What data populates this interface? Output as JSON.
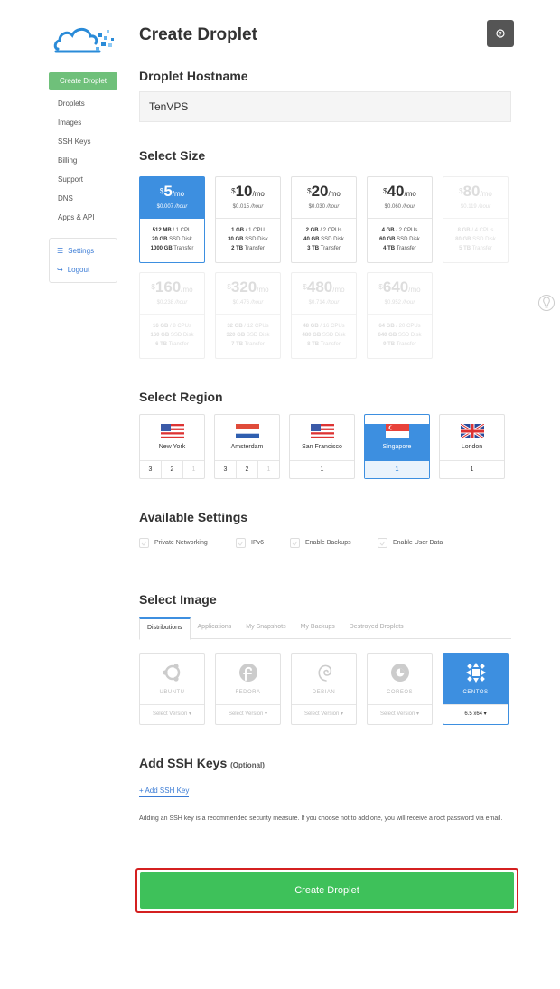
{
  "sidebar": {
    "primary": "Create Droplet",
    "items": [
      "Droplets",
      "Images",
      "SSH Keys",
      "Billing",
      "Support",
      "DNS",
      "Apps & API"
    ],
    "box_items": [
      {
        "label": "Settings",
        "icon": "sliders-icon"
      },
      {
        "label": "Logout",
        "icon": "logout-icon"
      }
    ]
  },
  "page_title": "Create Droplet",
  "hostname": {
    "title": "Droplet Hostname",
    "value": "TenVPS"
  },
  "size": {
    "title": "Select Size",
    "plans": [
      {
        "price": "5",
        "per": "/mo",
        "hourly": "$0.007",
        "hourly_unit": "/hour",
        "ram": "512 MB",
        "cpu": "/ 1 CPU",
        "disk": "20 GB",
        "disk_label": "SSD Disk",
        "transfer": "1000 GB",
        "transfer_label": "Transfer",
        "state": "selected"
      },
      {
        "price": "10",
        "per": "/mo",
        "hourly": "$0.015",
        "hourly_unit": "/hour",
        "ram": "1 GB",
        "cpu": "/ 1 CPU",
        "disk": "30 GB",
        "disk_label": "SSD Disk",
        "transfer": "2 TB",
        "transfer_label": "Transfer",
        "state": "normal"
      },
      {
        "price": "20",
        "per": "/mo",
        "hourly": "$0.030",
        "hourly_unit": "/hour",
        "ram": "2 GB",
        "cpu": "/ 2 CPUs",
        "disk": "40 GB",
        "disk_label": "SSD Disk",
        "transfer": "3 TB",
        "transfer_label": "Transfer",
        "state": "normal"
      },
      {
        "price": "40",
        "per": "/mo",
        "hourly": "$0.060",
        "hourly_unit": "/hour",
        "ram": "4 GB",
        "cpu": "/ 2 CPUs",
        "disk": "60 GB",
        "disk_label": "SSD Disk",
        "transfer": "4 TB",
        "transfer_label": "Transfer",
        "state": "normal"
      },
      {
        "price": "80",
        "per": "/mo",
        "hourly": "$0.119",
        "hourly_unit": "/hour",
        "ram": "8 GB",
        "cpu": "/ 4 CPUs",
        "disk": "80 GB",
        "disk_label": "SSD Disk",
        "transfer": "5 TB",
        "transfer_label": "Transfer",
        "state": "disabled"
      },
      {
        "price": "160",
        "per": "/mo",
        "hourly": "$0.238",
        "hourly_unit": "/hour",
        "ram": "16 GB",
        "cpu": "/ 8 CPUs",
        "disk": "160 GB",
        "disk_label": "SSD Disk",
        "transfer": "6 TB",
        "transfer_label": "Transfer",
        "state": "disabled"
      },
      {
        "price": "320",
        "per": "/mo",
        "hourly": "$0.476",
        "hourly_unit": "/hour",
        "ram": "32 GB",
        "cpu": "/ 12 CPUs",
        "disk": "320 GB",
        "disk_label": "SSD Disk",
        "transfer": "7 TB",
        "transfer_label": "Transfer",
        "state": "disabled"
      },
      {
        "price": "480",
        "per": "/mo",
        "hourly": "$0.714",
        "hourly_unit": "/hour",
        "ram": "48 GB",
        "cpu": "/ 16 CPUs",
        "disk": "480 GB",
        "disk_label": "SSD Disk",
        "transfer": "8 TB",
        "transfer_label": "Transfer",
        "state": "disabled"
      },
      {
        "price": "640",
        "per": "/mo",
        "hourly": "$0.952",
        "hourly_unit": "/hour",
        "ram": "64 GB",
        "cpu": "/ 20 CPUs",
        "disk": "640 GB",
        "disk_label": "SSD Disk",
        "transfer": "9 TB",
        "transfer_label": "Transfer",
        "state": "disabled"
      }
    ]
  },
  "region": {
    "title": "Select Region",
    "regions": [
      {
        "name": "New York",
        "flag": "us",
        "nums": [
          {
            "v": "3",
            "dim": false
          },
          {
            "v": "2",
            "dim": false
          },
          {
            "v": "1",
            "dim": true
          }
        ],
        "selected": false
      },
      {
        "name": "Amsterdam",
        "flag": "nl",
        "nums": [
          {
            "v": "3",
            "dim": false
          },
          {
            "v": "2",
            "dim": false
          },
          {
            "v": "1",
            "dim": true
          }
        ],
        "selected": false
      },
      {
        "name": "San Francisco",
        "flag": "us",
        "nums": [
          {
            "v": "1",
            "dim": false
          }
        ],
        "selected": false
      },
      {
        "name": "Singapore",
        "flag": "sg",
        "nums": [
          {
            "v": "1",
            "dim": false
          }
        ],
        "selected": true
      },
      {
        "name": "London",
        "flag": "uk",
        "nums": [
          {
            "v": "1",
            "dim": false
          }
        ],
        "selected": false
      }
    ]
  },
  "settings": {
    "title": "Available Settings",
    "options": [
      "Private Networking",
      "IPv6",
      "Enable Backups",
      "Enable User Data"
    ]
  },
  "image": {
    "title": "Select Image",
    "tabs": [
      "Distributions",
      "Applications",
      "My Snapshots",
      "My Backups",
      "Destroyed Droplets"
    ],
    "active_tab": 0,
    "distros": [
      {
        "name": "UBUNTU",
        "icon": "ubuntu-icon",
        "version": "Select Version",
        "selected": false
      },
      {
        "name": "FEDORA",
        "icon": "fedora-icon",
        "version": "Select Version",
        "selected": false
      },
      {
        "name": "DEBIAN",
        "icon": "debian-icon",
        "version": "Select Version",
        "selected": false
      },
      {
        "name": "COREOS",
        "icon": "coreos-icon",
        "version": "Select Version",
        "selected": false
      },
      {
        "name": "CENTOS",
        "icon": "centos-icon",
        "version": "6.5 x64",
        "selected": true
      }
    ]
  },
  "ssh": {
    "title": "Add SSH Keys",
    "optional": "(Optional)",
    "add_label": "Add SSH Key",
    "note": "Adding an SSH key is a recommended security measure. If you choose not to add one, you will receive a root password via email."
  },
  "create_button": "Create Droplet",
  "colors": {
    "accent": "#3d8fe0",
    "primary_green": "#3ec15a",
    "sidebar_green": "#6fc07a",
    "highlight": "#d42020"
  }
}
